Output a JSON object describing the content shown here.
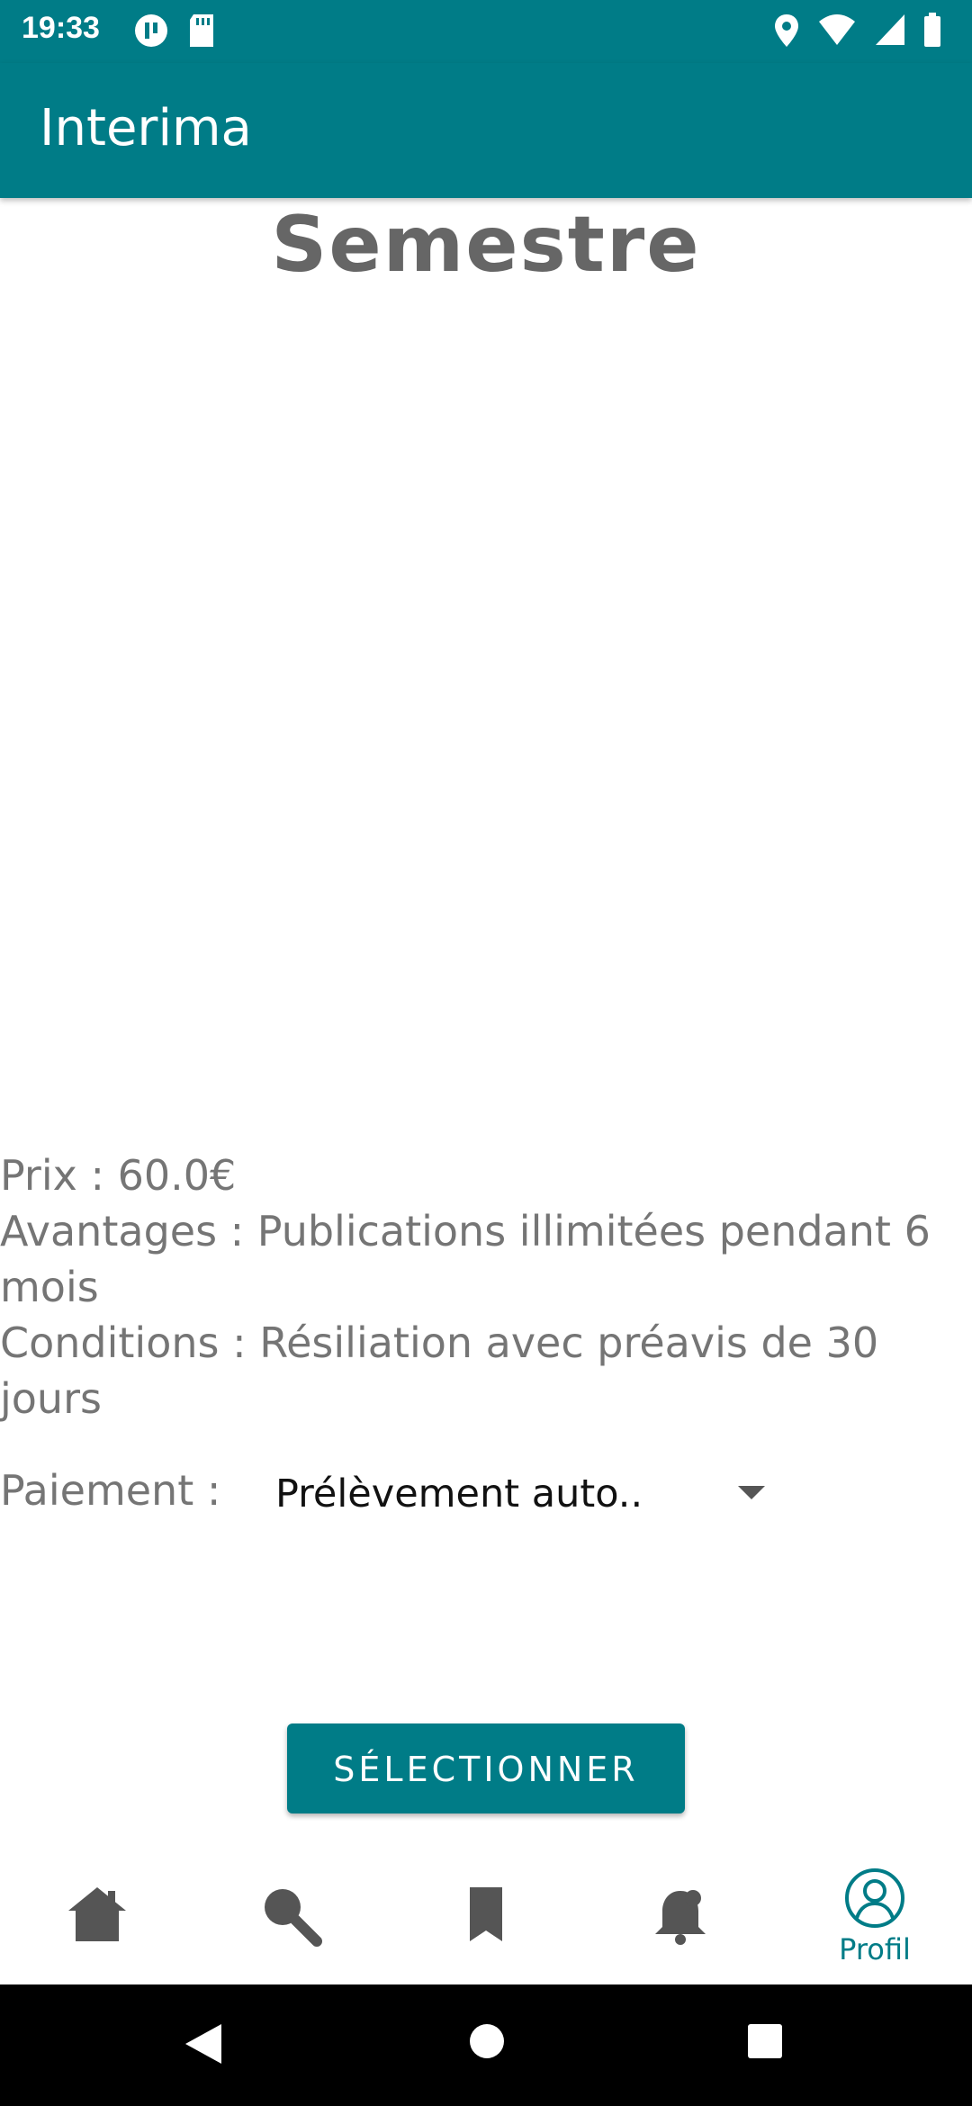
{
  "status_bar": {
    "time": "19:33",
    "icons_left": [
      "pause-media-icon",
      "sd-card-icon"
    ],
    "icons_right": [
      "location-icon",
      "wifi-icon",
      "signal-icon",
      "battery-icon"
    ]
  },
  "app_bar": {
    "title": "Interima"
  },
  "plan": {
    "title": "Semestre",
    "price_line": "Prix : 60.0€",
    "advantages_line": "Avantages : Publications illimitées pendant 6 mois",
    "conditions_line": "Conditions : Résiliation avec préavis de 30 jours"
  },
  "payment": {
    "label": "Paiement :",
    "selected": "Prélèvement auto.."
  },
  "actions": {
    "select_label": "SÉLECTIONNER"
  },
  "bottom_nav": {
    "items": [
      {
        "icon": "home-icon",
        "label": ""
      },
      {
        "icon": "search-icon",
        "label": ""
      },
      {
        "icon": "bookmark-icon",
        "label": ""
      },
      {
        "icon": "notification-bell-icon",
        "label": ""
      },
      {
        "icon": "profile-icon",
        "label": "Profil",
        "active": true
      }
    ]
  },
  "colors": {
    "primary": "#007C87",
    "text_secondary": "#757575",
    "title_gray": "#666666"
  }
}
